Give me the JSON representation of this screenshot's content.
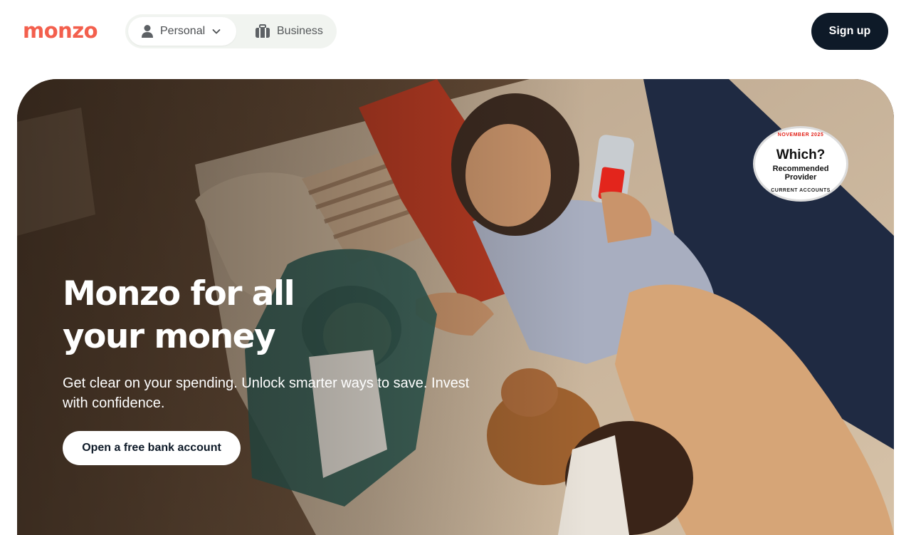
{
  "header": {
    "logo": "monzo",
    "segment": {
      "personal_label": "Personal",
      "business_label": "Business"
    },
    "signup_label": "Sign up"
  },
  "hero": {
    "headline": "Monzo for all your money",
    "subtext": "Get clear on your spending. Unlock smarter ways to save. Invest with confidence.",
    "cta_label": "Open a free bank account",
    "badge": {
      "month": "NOVEMBER 2025",
      "brand": "Which?",
      "line1": "Recommended",
      "line2": "Provider",
      "category": "CURRENT ACCOUNTS"
    }
  },
  "icons": {
    "person": "person-icon",
    "chevron": "chevron-down-icon",
    "briefcase": "briefcase-icon"
  },
  "colors": {
    "brand": "#f35f4d",
    "navy": "#0e1a28",
    "segment_bg": "#f1f4f0",
    "badge_red": "#e2231a"
  }
}
